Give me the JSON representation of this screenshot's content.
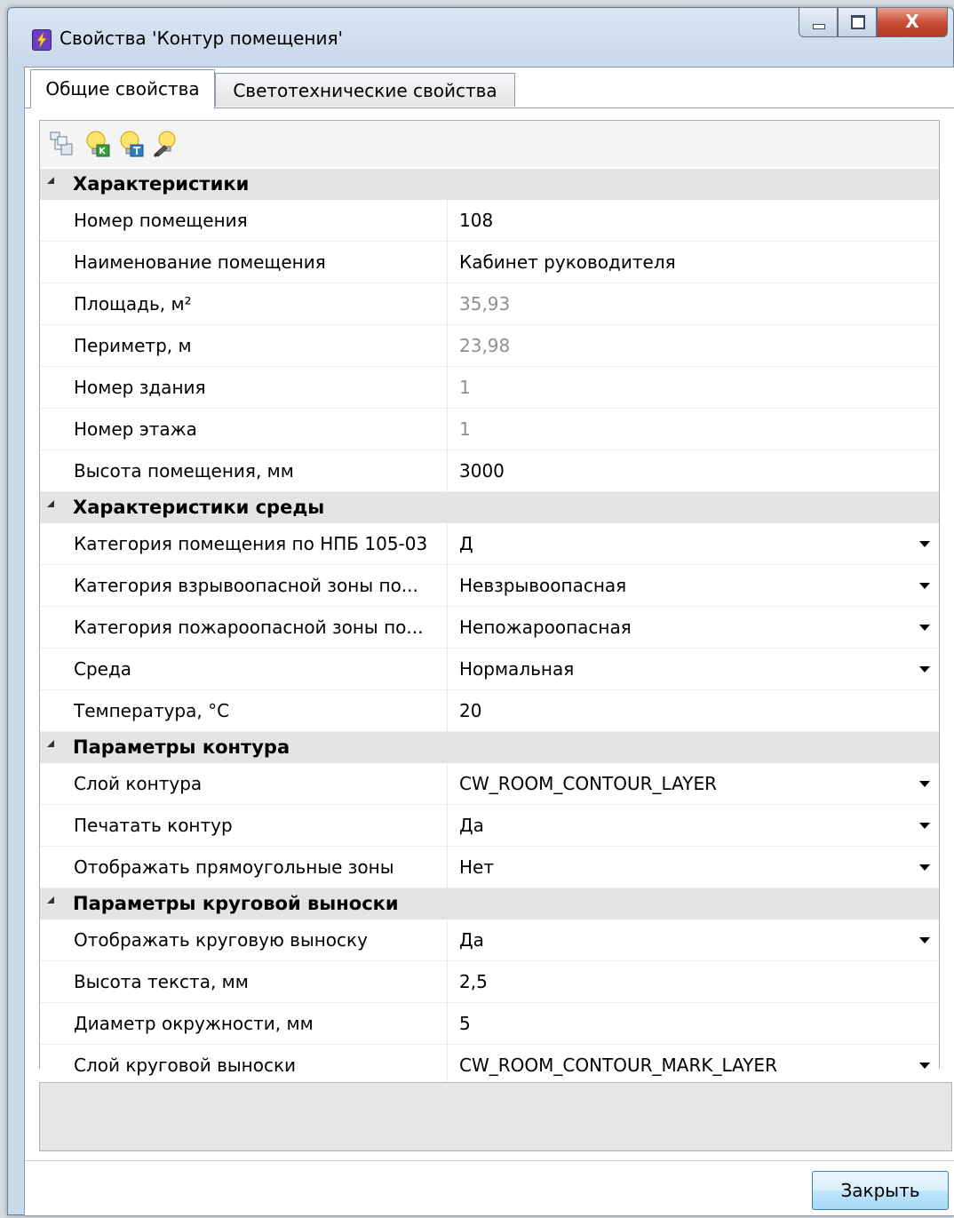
{
  "window": {
    "title": "Свойства 'Контур помещения'",
    "close_glyph": "X"
  },
  "tabs": [
    {
      "label": "Общие свойства",
      "active": true
    },
    {
      "label": "Светотехнические свойства",
      "active": false
    }
  ],
  "toolbar": {
    "icons": [
      "object-tree-icon",
      "lamp-k-icon",
      "lamp-t-icon",
      "lamp-brush-icon"
    ]
  },
  "groups": [
    {
      "label": "Характеристики",
      "props": [
        {
          "name": "Номер помещения",
          "value": "108",
          "readonly": false,
          "dropdown": false
        },
        {
          "name": "Наименование помещения",
          "value": "Кабинет руководителя",
          "readonly": false,
          "dropdown": false
        },
        {
          "name": "Площадь, м²",
          "value": "35,93",
          "readonly": true,
          "dropdown": false
        },
        {
          "name": "Периметр, м",
          "value": "23,98",
          "readonly": true,
          "dropdown": false
        },
        {
          "name": "Номер здания",
          "value": "1",
          "readonly": true,
          "dropdown": false
        },
        {
          "name": "Номер этажа",
          "value": "1",
          "readonly": true,
          "dropdown": false
        },
        {
          "name": "Высота помещения, мм",
          "value": "3000",
          "readonly": false,
          "dropdown": false
        }
      ]
    },
    {
      "label": "Характеристики среды",
      "props": [
        {
          "name": "Категория помещения по НПБ 105-03",
          "value": "Д",
          "readonly": false,
          "dropdown": true
        },
        {
          "name": "Категория взрывоопасной зоны по...",
          "value": "Невзрывоопасная",
          "readonly": false,
          "dropdown": true
        },
        {
          "name": "Категория пожароопасной зоны по...",
          "value": "Непожароопасная",
          "readonly": false,
          "dropdown": true
        },
        {
          "name": "Среда",
          "value": "Нормальная",
          "readonly": false,
          "dropdown": true
        },
        {
          "name": "Температура, °C",
          "value": "20",
          "readonly": false,
          "dropdown": false
        }
      ]
    },
    {
      "label": "Параметры контура",
      "props": [
        {
          "name": "Слой контура",
          "value": "CW_ROOM_CONTOUR_LAYER",
          "readonly": false,
          "dropdown": true
        },
        {
          "name": "Печатать контур",
          "value": "Да",
          "readonly": false,
          "dropdown": true
        },
        {
          "name": "Отображать прямоугольные зоны",
          "value": "Нет",
          "readonly": false,
          "dropdown": true
        }
      ]
    },
    {
      "label": "Параметры круговой выноски",
      "props": [
        {
          "name": "Отображать круговую выноску",
          "value": "Да",
          "readonly": false,
          "dropdown": true
        },
        {
          "name": "Высота текста, мм",
          "value": "2,5",
          "readonly": false,
          "dropdown": false
        },
        {
          "name": "Диаметр окружности, мм",
          "value": "5",
          "readonly": false,
          "dropdown": false
        },
        {
          "name": "Слой круговой выноски",
          "value": "CW_ROOM_CONTOUR_MARK_LAYER",
          "readonly": false,
          "dropdown": true
        }
      ]
    }
  ],
  "footer": {
    "close_label": "Закрыть"
  },
  "colors": {
    "readonly_text": "#8f8f8f",
    "category_bg": "#e4e4e4",
    "close_button_red": "#c74a33"
  }
}
